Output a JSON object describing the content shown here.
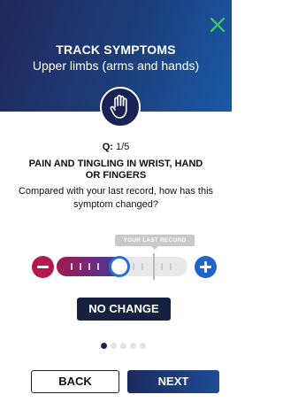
{
  "colors": {
    "header_gradient_start": "#21285c",
    "header_gradient_end": "#1a5aa8",
    "close_icon": "#3fbf6b",
    "minus_button": "#b4194f",
    "plus_button": "#1f65c8",
    "badge_dark": "#16213f"
  },
  "header": {
    "title": "TRACK SYMPTOMS",
    "subtitle": "Upper limbs (arms and hands)",
    "close_icon": "close-icon",
    "badge_icon": "raised-hand-icon"
  },
  "question": {
    "prefix": "Q:",
    "number": "1/5",
    "title": "PAIN AND TINGLING IN WRIST, HAND OR FINGERS",
    "description": "Compared with your last record, how has this symptom changed?"
  },
  "slider": {
    "last_record_label": "YOUR LAST RECORD",
    "value_fraction": 0.48,
    "last_record_fraction": 0.74,
    "decrease_icon": "minus-icon",
    "increase_icon": "plus-icon"
  },
  "status": {
    "label": "NO CHANGE"
  },
  "pagination": {
    "total": 5,
    "current": 1
  },
  "footer": {
    "back_label": "BACK",
    "next_label": "NEXT"
  }
}
